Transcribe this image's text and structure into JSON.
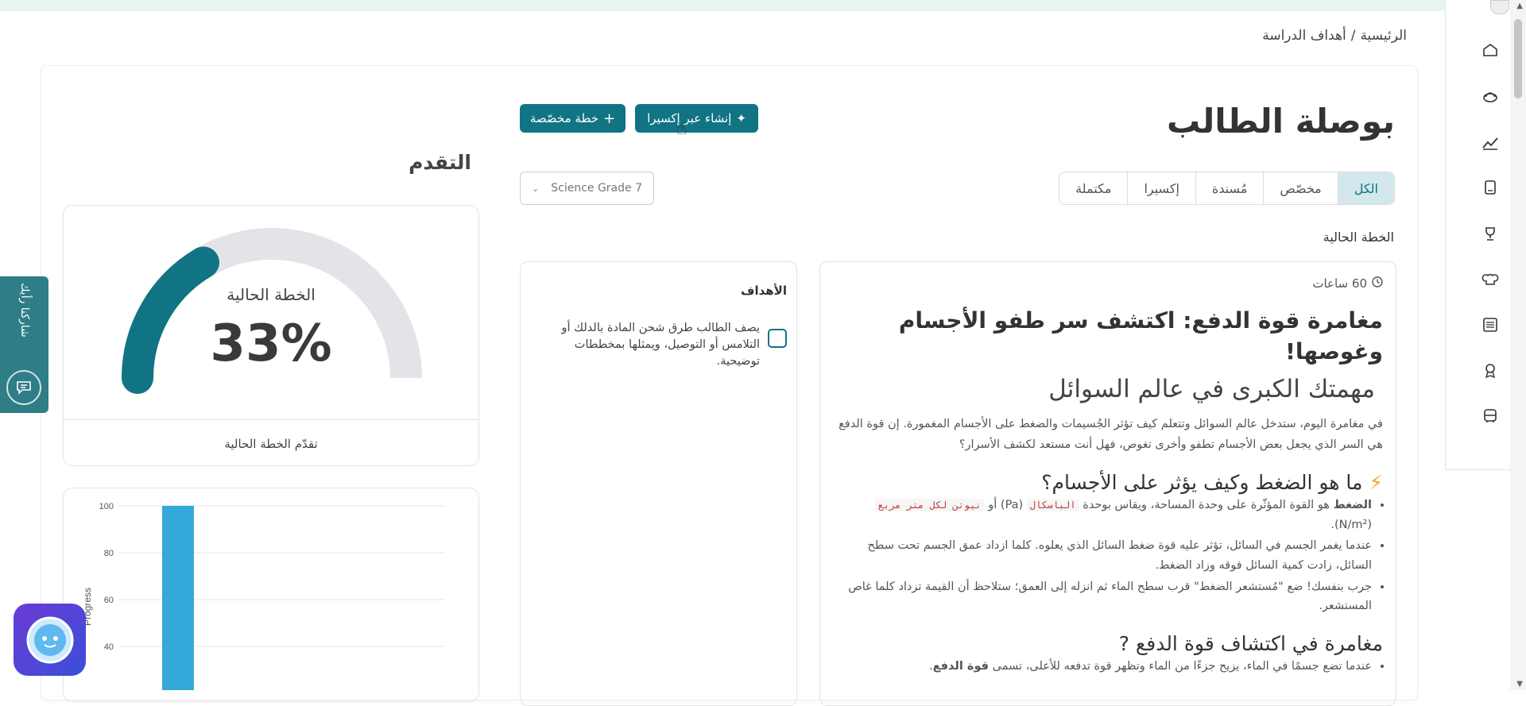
{
  "breadcrumb": {
    "home": "الرئيسية",
    "separator": "/",
    "current": "أهداف الدراسة"
  },
  "page": {
    "title": "بوصلة الطالب"
  },
  "actions": {
    "custom_plan": "خطة مخصّصة",
    "create_ai": "إنشاء عبر إكسيرا"
  },
  "tabs": [
    "الكل",
    "مخصّص",
    "مُسندة",
    "إكسيرا",
    "مكتملة"
  ],
  "grade_select": {
    "value": "Science Grade 7"
  },
  "current_plan_label": "الخطة الحالية",
  "plan": {
    "hours": "60 ساعات",
    "title": "مغامرة قوة الدفع: اكتشف سر طفو الأجسام وغوصها!",
    "mission_title": "مهمتك الكبرى في عالم السوائل",
    "intro": "في مغامرة اليوم، ستدخل عالم السوائل وتتعلم كيف تؤثر الجُسيمات والضغط على الأجسام المغمورة. إن قوة الدفع هي السر الذي يجعل بعض الأجسام تطفو وأخرى تغوص، فهل أنت مستعد لكشف الأسرار؟",
    "section1_title": "ما هو الضغط وكيف يؤثر على الأجسام؟",
    "section1_bullet1_bold": "الضغط",
    "section1_bullet1_rest": " هو القوة المؤثّرة على وحدة المساحة، ويقاس بوحدة ",
    "section1_code1": "الباسكال",
    "section1_bullet1_mid": " (Pa) أو ",
    "section1_code2": "نيوتن لكل متر مربع",
    "section1_bullet1_end": " (N/m²).",
    "section1_bullet2": "عندما يغمر الجسم في السائل، تؤثر عليه قوة ضغط السائل الذي يعلوه. كلما ازداد عمق الجسم تحت سطح السائل، زادت كمية السائل فوقه وزاد الضغط.",
    "section1_bullet3": "جرب بنفسك! ضع \"مُستشعر الضغط\" قرب سطح الماء ثم انزله إلى العمق؛ ستلاحظ أن القيمة تزداد كلما غاص المستشعر.",
    "section2_title": "مغامرة في اكتشاف قوة الدفع ?",
    "section2_bullet1_rest": "عندما تضع جسمًا في الماء، يزيح جزءًا من الماء وتظهر قوة تدفعه للأعلى، تسمى ",
    "section2_bullet1_bold": "قوة الدفع",
    "section2_bullet1_end": "."
  },
  "goals": {
    "title": "الأهداف",
    "items": [
      "يصف الطالب طرق شحن المادة بالدلك أو التلامس أو التوصيل، ويمثلها بمخططات توضيحية."
    ]
  },
  "progress": {
    "title": "التقدم",
    "gauge_label": "الخطة الحالية",
    "gauge_value_text": "33%",
    "gauge_fraction": 0.33,
    "gauge_caption": "تقدّم الخطة الحالية"
  },
  "feedback": {
    "label": "شاركنا رأيك"
  },
  "chart_data": {
    "type": "bar",
    "ylabel": "Progress",
    "ylim": [
      0,
      100
    ],
    "yticks": [
      "20",
      "40",
      "60",
      "80",
      "100"
    ],
    "values": [
      100
    ]
  },
  "colors": {
    "primary": "#107484",
    "bar": "#33a9d9",
    "gauge_track": "#e4e4e8"
  },
  "icons": [
    "home-icon",
    "hat-icon",
    "chart-line-icon",
    "book-icon",
    "trophy-icon",
    "chef-hat-icon",
    "list-icon",
    "badge-icon",
    "bus-icon"
  ]
}
